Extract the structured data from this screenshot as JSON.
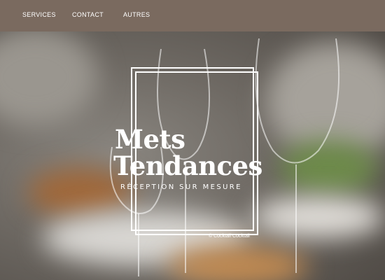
{
  "nav": {
    "items": [
      {
        "label": "SERVICES"
      },
      {
        "label": "CONTACT"
      },
      {
        "label": "AUTRES"
      }
    ]
  },
  "hero": {
    "title_line1": "Mets",
    "title_line2": "Tendances",
    "subtitle": "RÉCEPTION SUR MESURE",
    "credit": "© Cocktail Cocktail"
  },
  "colors": {
    "nav_bg": "#7a6a5f",
    "text": "#ffffff"
  }
}
